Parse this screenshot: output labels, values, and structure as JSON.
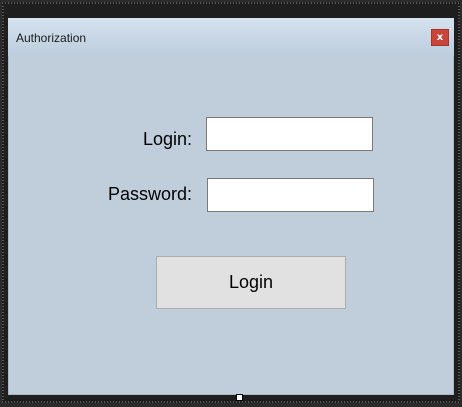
{
  "window": {
    "title": "Authorization",
    "close_label": "x"
  },
  "form": {
    "login_label": "Login:",
    "login_value": "",
    "password_label": "Password:",
    "password_value": "",
    "submit_label": "Login"
  },
  "colors": {
    "form_background": "#c0cedb",
    "titlebar_top": "#d6e2ef",
    "close_button": "#c9453a",
    "button_face": "#e1e1e1"
  }
}
